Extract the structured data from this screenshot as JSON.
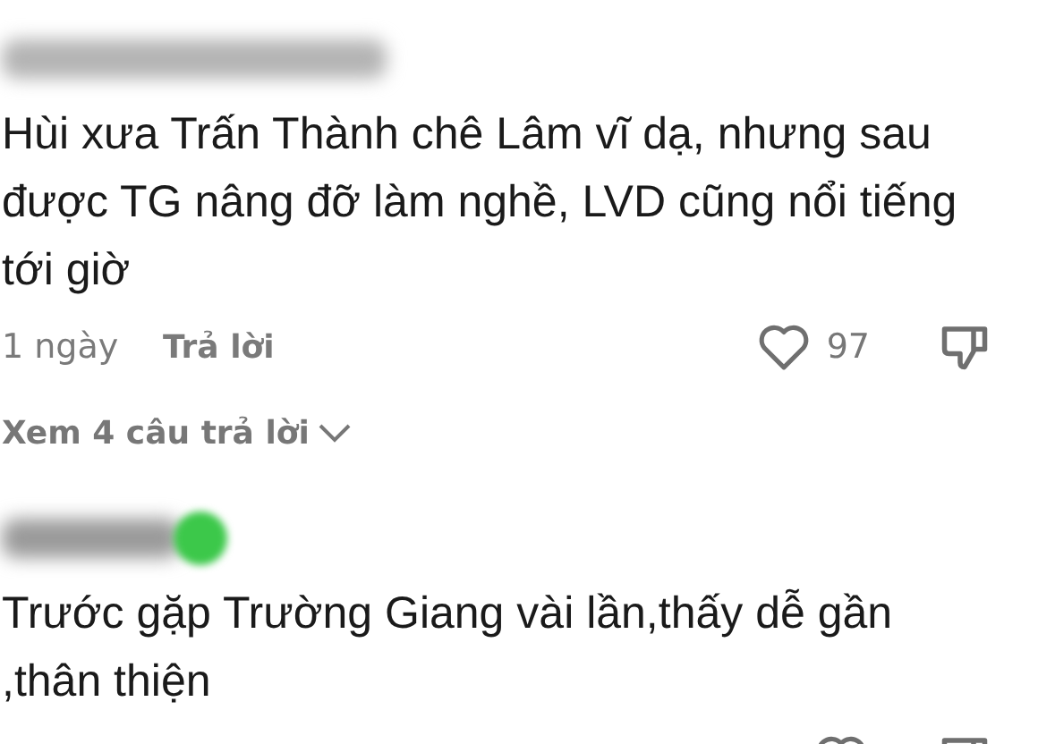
{
  "comments": [
    {
      "kind": "blurred_name",
      "text": "Hùi xưa Trấn Thành chê Lâm vĩ dạ, nhưng sau được TG nâng đỡ làm nghề, LVD cũng nổi tiếng tới giờ",
      "time": "1 ngày",
      "reply_label": "Trả lời",
      "likes": "97",
      "view_replies": "Xem 4 câu trả lời"
    },
    {
      "kind": "blurred_name_with_emoji",
      "text": "Trước gặp Trường Giang vài lần,thấy dễ gần ,thân thiện"
    }
  ]
}
